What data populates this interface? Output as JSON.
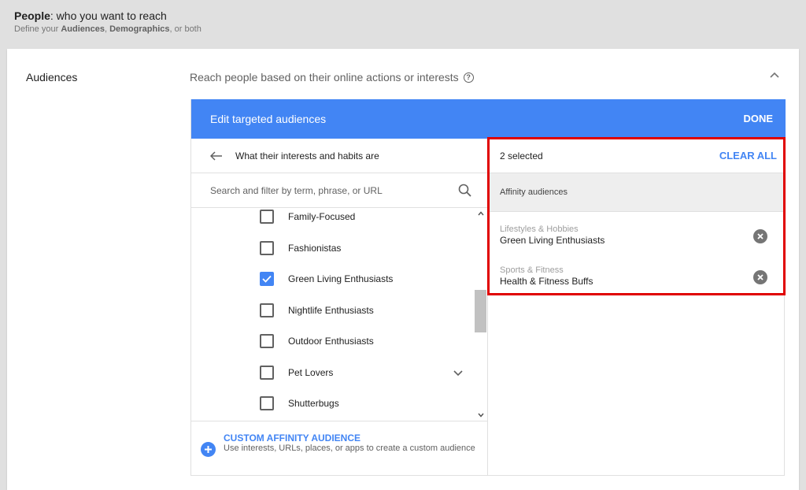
{
  "header": {
    "title_bold": "People",
    "title_rest": ": who you want to reach",
    "sub_prefix": "Define your ",
    "sub_bold1": "Audiences",
    "sub_mid": ", ",
    "sub_bold2": "Demographics",
    "sub_suffix": ", or both"
  },
  "section": {
    "label": "Audiences",
    "description": "Reach people based on their online actions or interests",
    "help_icon": "help-circle-icon",
    "help_glyph": "?",
    "collapse_icon": "chevron-up-icon"
  },
  "editor": {
    "title": "Edit targeted audiences",
    "done_label": "DONE",
    "accent_color": "#4285f4"
  },
  "browse": {
    "back_label": "What their interests and habits are",
    "search_placeholder": "Search and filter by term, phrase, or URL",
    "items": [
      {
        "label": "Family-Focused",
        "checked": false
      },
      {
        "label": "Fashionistas",
        "checked": false
      },
      {
        "label": "Green Living Enthusiasts",
        "checked": true
      },
      {
        "label": "Nightlife Enthusiasts",
        "checked": false
      },
      {
        "label": "Outdoor Enthusiasts",
        "checked": false
      },
      {
        "label": "Pet Lovers",
        "checked": false,
        "expandable": true
      },
      {
        "label": "Shutterbugs",
        "checked": false
      }
    ]
  },
  "custom": {
    "title": "CUSTOM AFFINITY AUDIENCE",
    "description": "Use interests, URLs, places, or apps to create a custom audience"
  },
  "selected": {
    "count_label": "2 selected",
    "clear_label": "CLEAR ALL",
    "group_label": "Affinity audiences",
    "items": [
      {
        "category": "Lifestyles & Hobbies",
        "name": "Green Living Enthusiasts"
      },
      {
        "category": "Sports & Fitness",
        "name": "Health & Fitness Buffs"
      }
    ]
  },
  "annotation": {
    "highlight_color": "#e00000"
  }
}
